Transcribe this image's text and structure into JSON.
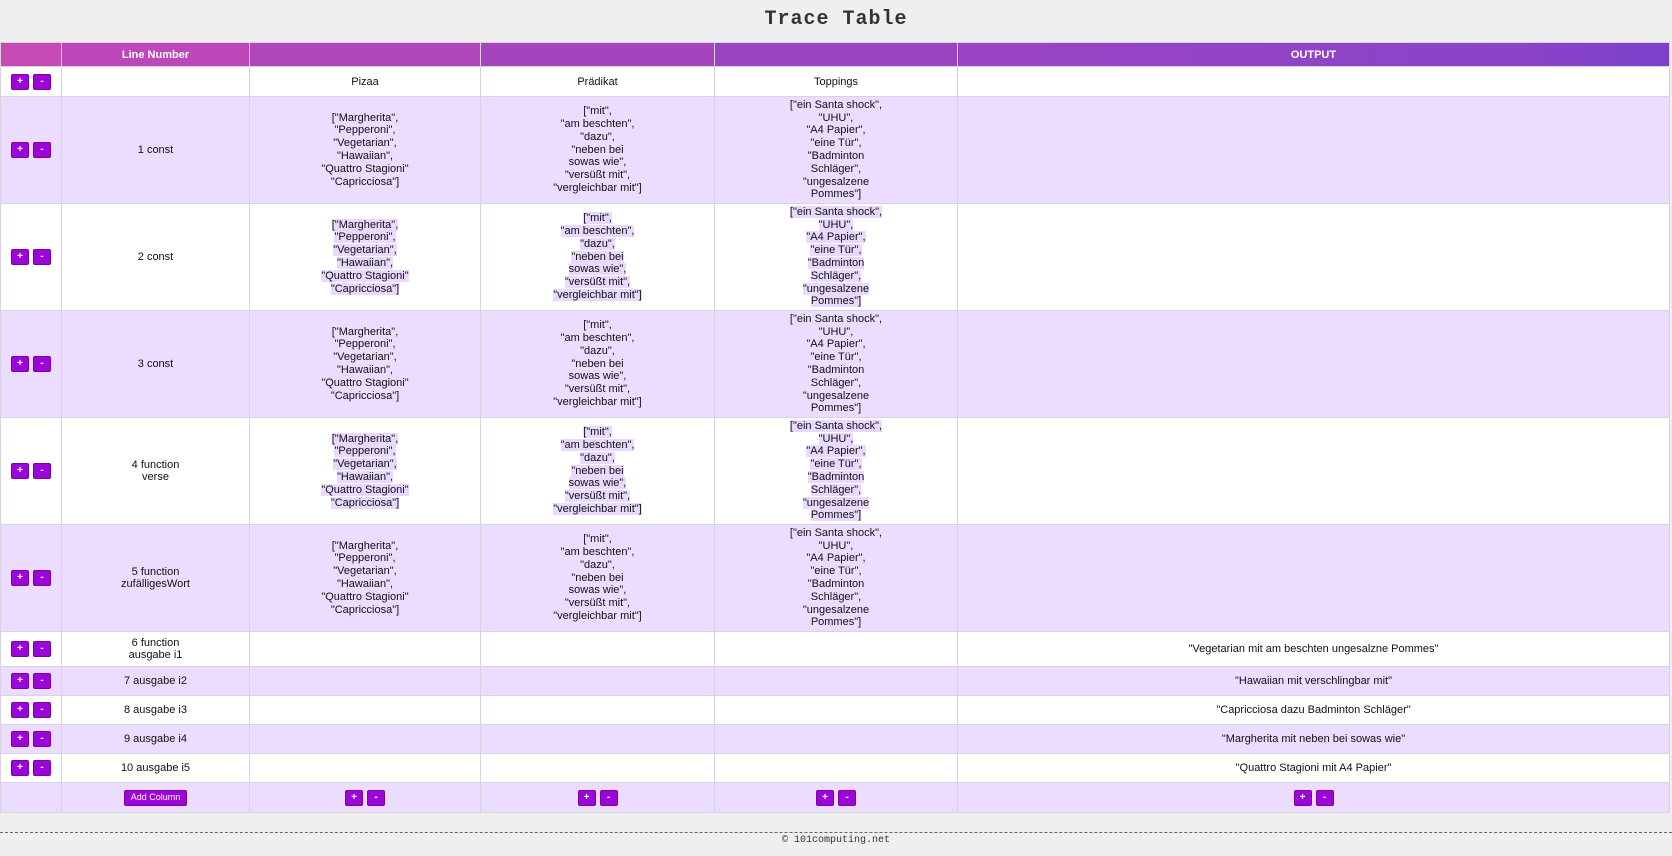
{
  "title": "Trace Table",
  "header": {
    "line_number": "Line Number",
    "output": "OUTPUT"
  },
  "columns": [
    "Pizaa",
    "Prädikat",
    "Toppings"
  ],
  "buttons": {
    "plus": "+",
    "minus": "-",
    "add_column": "Add Column"
  },
  "values": {
    "pizza": "[\"Margherita\",\n\"Pepperoni\",\n\"Vegetarian\",\n\"Hawaiian\",\n\"Quattro Stagioni\"\n\"Capricciosa\"]",
    "praedikat": "[\"mit\",\n\"am beschten\",\n\"dazu\",\n\"neben bei\nsowas wie\",\n\"versüßt mit\",\n\"vergleichbar mit\"]",
    "toppings": "[\"ein Santa shock\",\n\"UHU\",\n\"A4 Papier\",\n\"eine Tür\",\n\"Badminton\nSchläger\",\n\"ungesalzene\nPommes\"]"
  },
  "rows": [
    {
      "line": "1 const"
    },
    {
      "line": "2 const"
    },
    {
      "line": "3 const"
    },
    {
      "line": "4 function\nverse"
    },
    {
      "line": "5 function\nzufälligesWort"
    },
    {
      "line": "6 function\nausgabe i1",
      "output": "\"Vegetarian mit am beschten ungesalzne Pommes\""
    },
    {
      "line": "7 ausgabe i2",
      "output": "\"Hawaiian mit verschlingbar mit\""
    },
    {
      "line": "8 ausgabe i3",
      "output": "\"Capricciosa dazu Badminton Schläger\""
    },
    {
      "line": "9 ausgabe i4",
      "output": "\"Margherita mit neben bei sowas wie\""
    },
    {
      "line": "10 ausgabe i5",
      "output": "\"Quattro Stagioni mit A4 Papier\""
    }
  ],
  "footer": "© 101computing.net"
}
